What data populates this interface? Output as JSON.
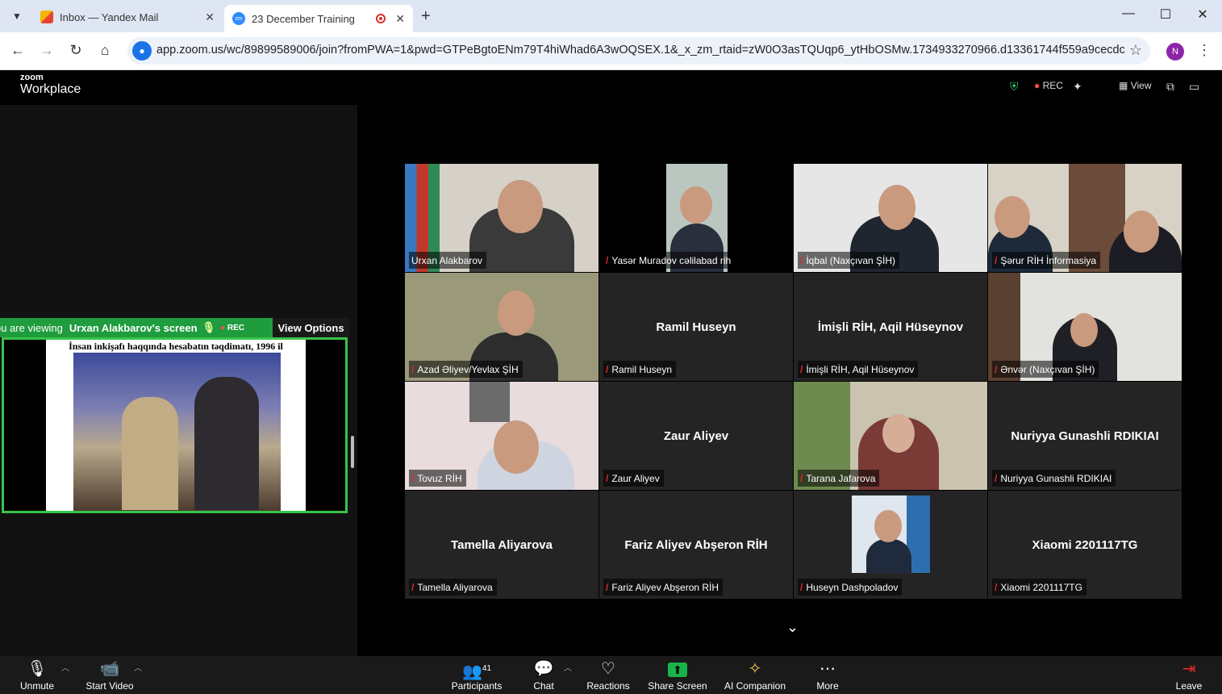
{
  "browser": {
    "tabs": [
      {
        "title": "Inbox — Yandex Mail",
        "favicon": "yandex-mail-icon"
      },
      {
        "title": "23 December Training",
        "favicon": "zoom-icon"
      }
    ],
    "url": "app.zoom.us/wc/89899589006/join?fromPWA=1&pwd=GTPeBgtoENm79T4hiWhad6A3wOQSEX.1&_x_zm_rtaid=zW0O3asTQUqp6_ytHbOSMw.1734933270966.d13361744f559a9cecdc625565...",
    "profile_initial": "N",
    "zoom_favicon_text": "zm"
  },
  "zoom": {
    "logo_small": "zoom",
    "logo_big": "Workplace",
    "topbar": {
      "rec": "REC",
      "view": "View"
    },
    "share": {
      "viewing_prefix": "ou are viewing",
      "presenter": "Urxan Alakbarov's screen",
      "rec": "REC",
      "view_options": "View Options",
      "slide_caption": "İnsan inkişafı haqqında hesabatın təqdimatı, 1996 il"
    },
    "tiles": [
      {
        "name": "Urxan Alakbarov",
        "video": true
      },
      {
        "name": "Yasər Muradov cəlilabad rih",
        "video": true
      },
      {
        "name": "İqbal (Naxçıvan ŞİH)",
        "video": true
      },
      {
        "name": "Şərur RİH İnformasiya",
        "video": true
      },
      {
        "name": "Azad Əliyev/Yevlax ŞİH",
        "video": true
      },
      {
        "name": "Ramil Huseyn",
        "video": false
      },
      {
        "name": "İmişli RİH, Aqil Hüseynov",
        "video": false
      },
      {
        "name": "Ənvər (Naxçıvan ŞİH)",
        "video": true
      },
      {
        "name": "Tovuz RİH",
        "video": true
      },
      {
        "name": "Zaur Aliyev",
        "video": false
      },
      {
        "name": "Tarana Jafarova",
        "video": true
      },
      {
        "name": "Nuriyya Gunashli RDIKIAI",
        "video": false
      },
      {
        "name": "Tamella Aliyarova",
        "video": false
      },
      {
        "name": "Fariz Aliyev Abşeron RİH",
        "video": false
      },
      {
        "name": "Huseyn Dashpoladov",
        "video": true
      },
      {
        "name": "Xiaomi 2201117TG",
        "video": false
      }
    ],
    "toolbar": {
      "unmute": "Unmute",
      "start_video": "Start Video",
      "participants": "Participants",
      "participants_count": "41",
      "chat": "Chat",
      "reactions": "Reactions",
      "share_screen": "Share Screen",
      "ai_companion": "AI Companion",
      "more": "More",
      "leave": "Leave"
    }
  },
  "colors": {
    "share_green": "#1f9c3e",
    "speaking_outline": "#c4e25a",
    "mute_red": "#e02828",
    "zoom_blue": "#2d8cff"
  }
}
